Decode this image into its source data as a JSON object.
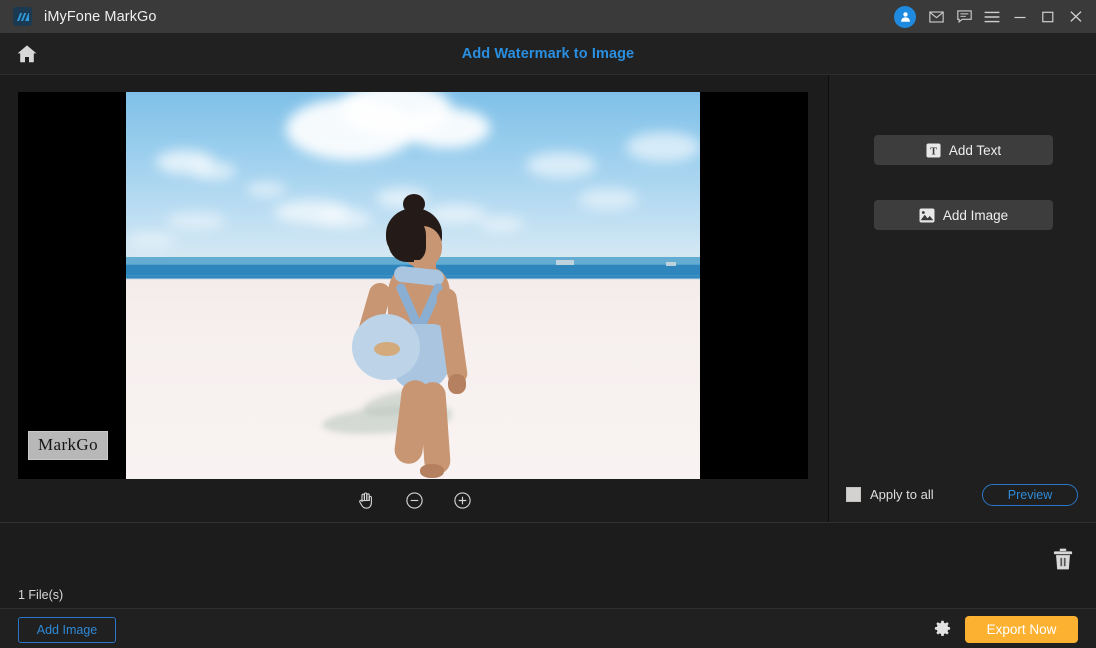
{
  "titlebar": {
    "app_name": "iMyFone MarkGo",
    "logo_icon": "markgo-logo-icon",
    "controls": [
      {
        "name": "account-avatar",
        "icon": "user-icon"
      },
      {
        "name": "mail-button",
        "icon": "envelope-icon"
      },
      {
        "name": "feedback-button",
        "icon": "chat-bubble-icon"
      },
      {
        "name": "menu-button",
        "icon": "hamburger-icon"
      },
      {
        "name": "minimize-button",
        "icon": "minimize-icon"
      },
      {
        "name": "maximize-button",
        "icon": "maximize-icon"
      },
      {
        "name": "close-button",
        "icon": "close-icon"
      }
    ]
  },
  "header": {
    "home_icon": "home-icon",
    "title": "Add Watermark to Image"
  },
  "canvas": {
    "watermark_text": "MarkGo",
    "tools": [
      {
        "name": "pan-tool",
        "icon": "hand-icon"
      },
      {
        "name": "zoom-out-button",
        "icon": "minus-circle-icon"
      },
      {
        "name": "zoom-in-button",
        "icon": "plus-circle-icon"
      }
    ]
  },
  "right_panel": {
    "add_text_label": "Add Text",
    "add_text_icon": "text-box-icon",
    "add_image_label": "Add Image",
    "add_image_icon": "picture-icon",
    "apply_to_all_label": "Apply to all",
    "apply_to_all_checked": false,
    "preview_label": "Preview"
  },
  "file_strip": {
    "delete_icon": "trash-icon",
    "file_count": "1 File(s)"
  },
  "bottom_bar": {
    "add_image_label": "Add Image",
    "settings_icon": "gear-icon",
    "export_label": "Export Now"
  },
  "colors": {
    "accent_blue": "#2a8fe0",
    "export_orange": "#fcb131",
    "titlebar": "#3a3a3a",
    "background": "#1c1c1c",
    "panel": "#1f1f1f",
    "button_grey": "#3d3d3d"
  }
}
